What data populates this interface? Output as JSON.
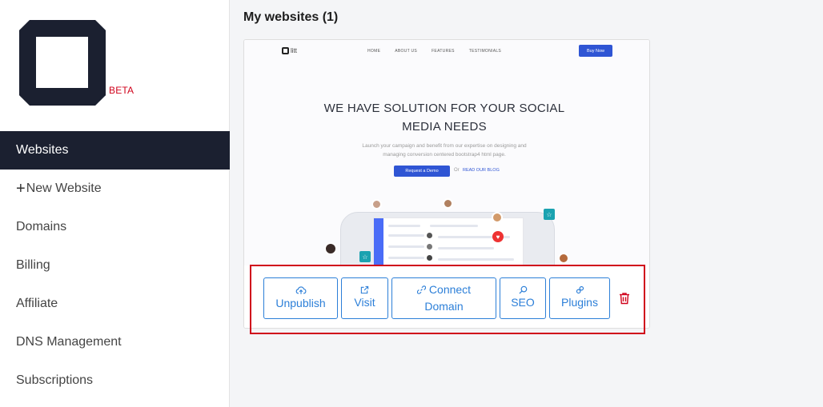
{
  "app": {
    "logo_name": "logo-icon",
    "beta_label": "BETA"
  },
  "sidebar": {
    "items": [
      {
        "label": "Websites",
        "active": true
      },
      {
        "label": "New Website",
        "icon": "plus-icon"
      },
      {
        "label": "Domains"
      },
      {
        "label": "Billing"
      },
      {
        "label": "Affiliate"
      },
      {
        "label": "DNS Management"
      },
      {
        "label": "Subscriptions"
      }
    ]
  },
  "main": {
    "heading": "My websites (1)",
    "website": {
      "preview": {
        "logo_text": "litt",
        "nav": [
          "HOME",
          "ABOUT US",
          "FEATURES",
          "TESTIMONIALS"
        ],
        "buy_label": "Buy Now",
        "title_line1": "WE HAVE SOLUTION FOR YOUR SOCIAL",
        "title_line2": "MEDIA NEEDS",
        "subtitle_line1": "Launch your campaign and benefit from our expertise on designing and",
        "subtitle_line2": "managing conversion centered bootstrap4 html page.",
        "demo_label": "Request a Demo",
        "or_label": "Or",
        "blog_label": "READ OUR BLOG"
      },
      "actions": {
        "unpublish": {
          "label": "Unpublish",
          "icon": "cloud-upload-icon"
        },
        "visit": {
          "label": "Visit",
          "icon": "external-link-icon"
        },
        "connect_domain": {
          "label_line1": "Connect",
          "label_line2": "Domain",
          "icon": "link-icon"
        },
        "seo": {
          "label": "SEO",
          "icon": "search-icon"
        },
        "plugins": {
          "label": "Plugins",
          "icon": "plug-icon"
        },
        "delete": {
          "icon": "trash-icon"
        }
      }
    }
  },
  "colors": {
    "sidebar_active_bg": "#1b2030",
    "accent": "#2c7fd8",
    "danger": "#d0021b"
  }
}
